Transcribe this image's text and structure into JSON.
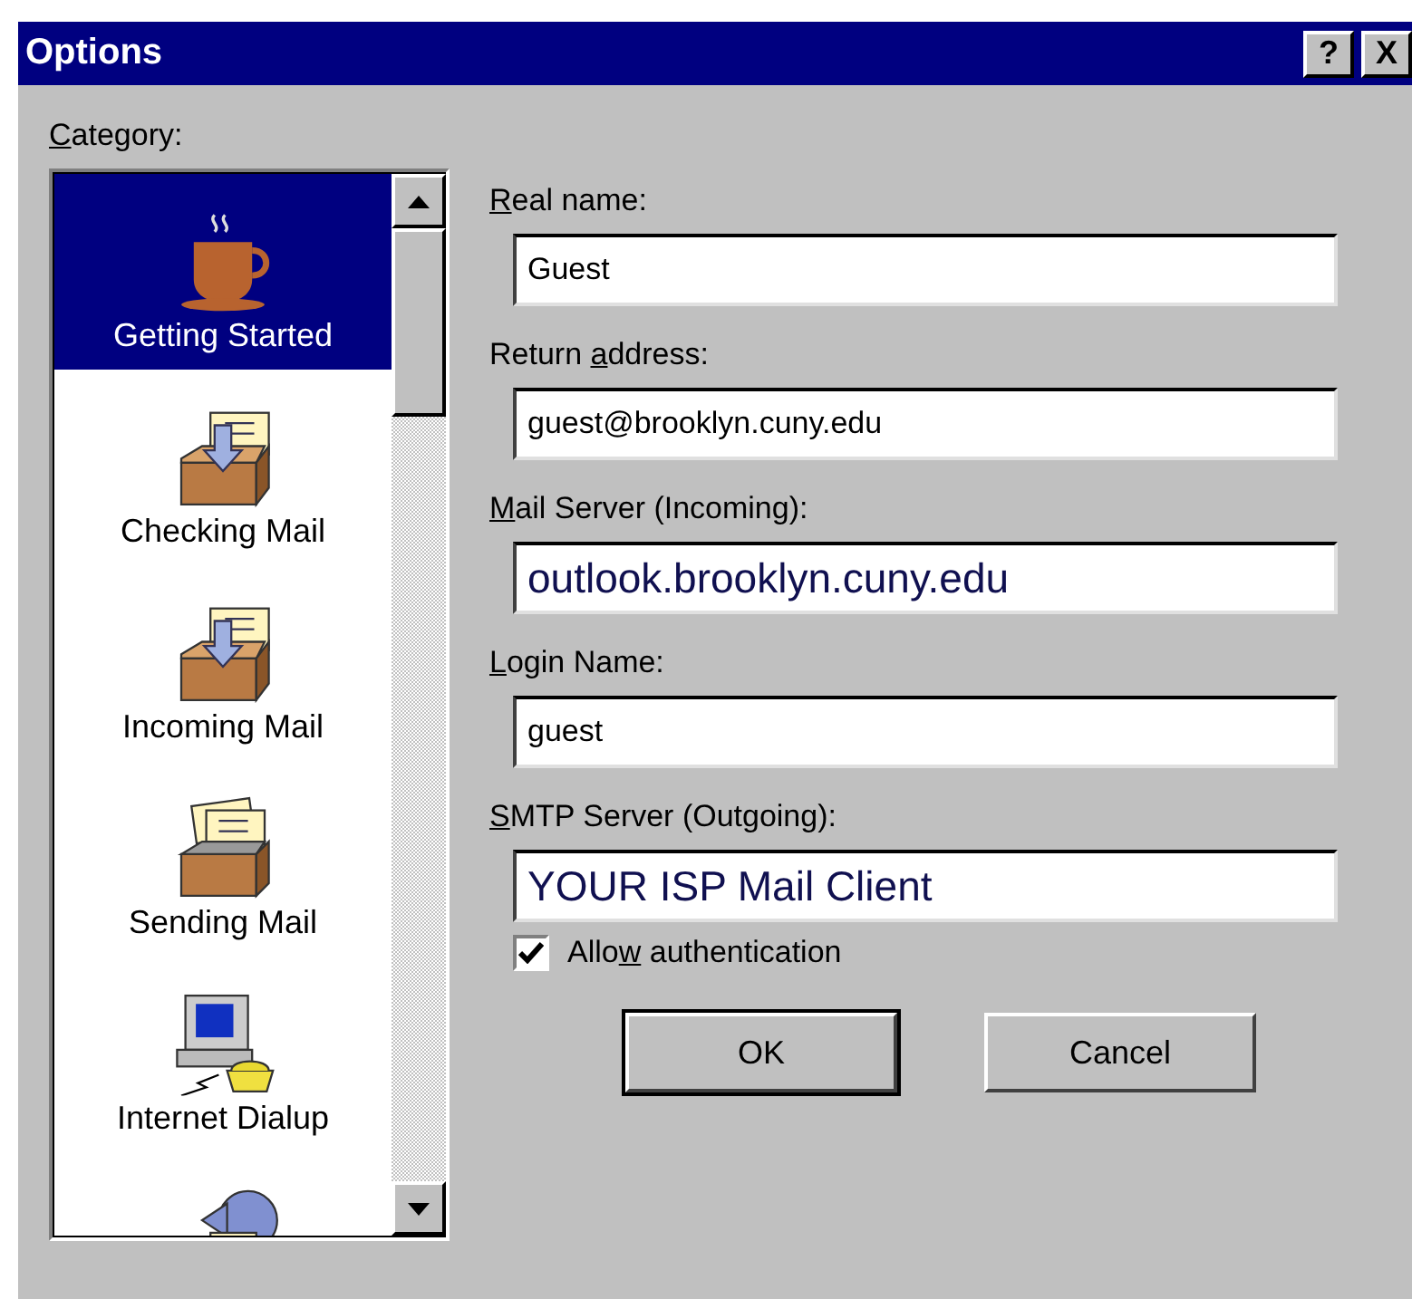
{
  "window": {
    "title": "Options",
    "title_buttons": [
      "?",
      "X"
    ]
  },
  "category": {
    "label": {
      "key": "C",
      "after": "ategory:"
    },
    "items": [
      {
        "kind": "cup",
        "label": "Getting Started",
        "selected": true
      },
      {
        "kind": "inbox",
        "label": "Checking Mail",
        "selected": false
      },
      {
        "kind": "inbox",
        "label": "Incoming Mail",
        "selected": false
      },
      {
        "kind": "outbox",
        "label": "Sending Mail",
        "selected": false
      },
      {
        "kind": "dialup",
        "label": "Internet Dialup",
        "selected": false
      },
      {
        "kind": "reply",
        "selected": false
      }
    ]
  },
  "fields": [
    {
      "label": {
        "key": "R",
        "after": "eal name:"
      },
      "value": "Guest",
      "kind": "plain"
    },
    {
      "label": {
        "before": "Return ",
        "key": "a",
        "after": "ddress:"
      },
      "value": "guest@brooklyn.cuny.edu",
      "kind": "plain"
    },
    {
      "label": {
        "key": "M",
        "after": "ail Server (Incoming):"
      },
      "value": "outlook.brooklyn.cuny.edu",
      "kind": "large"
    },
    {
      "label": {
        "key": "L",
        "after": "ogin Name:"
      },
      "value": "guest",
      "kind": "plain"
    },
    {
      "label": {
        "key": "S",
        "after": "MTP Server (Outgoing):"
      },
      "value": "YOUR ISP Mail Client",
      "kind": "large"
    }
  ],
  "checkbox": {
    "label": {
      "before": "Allo",
      "key": "w",
      "after": " authentication"
    },
    "checked": true
  },
  "buttons": [
    {
      "label": "OK",
      "default": true
    },
    {
      "label": "Cancel",
      "default": false
    }
  ]
}
